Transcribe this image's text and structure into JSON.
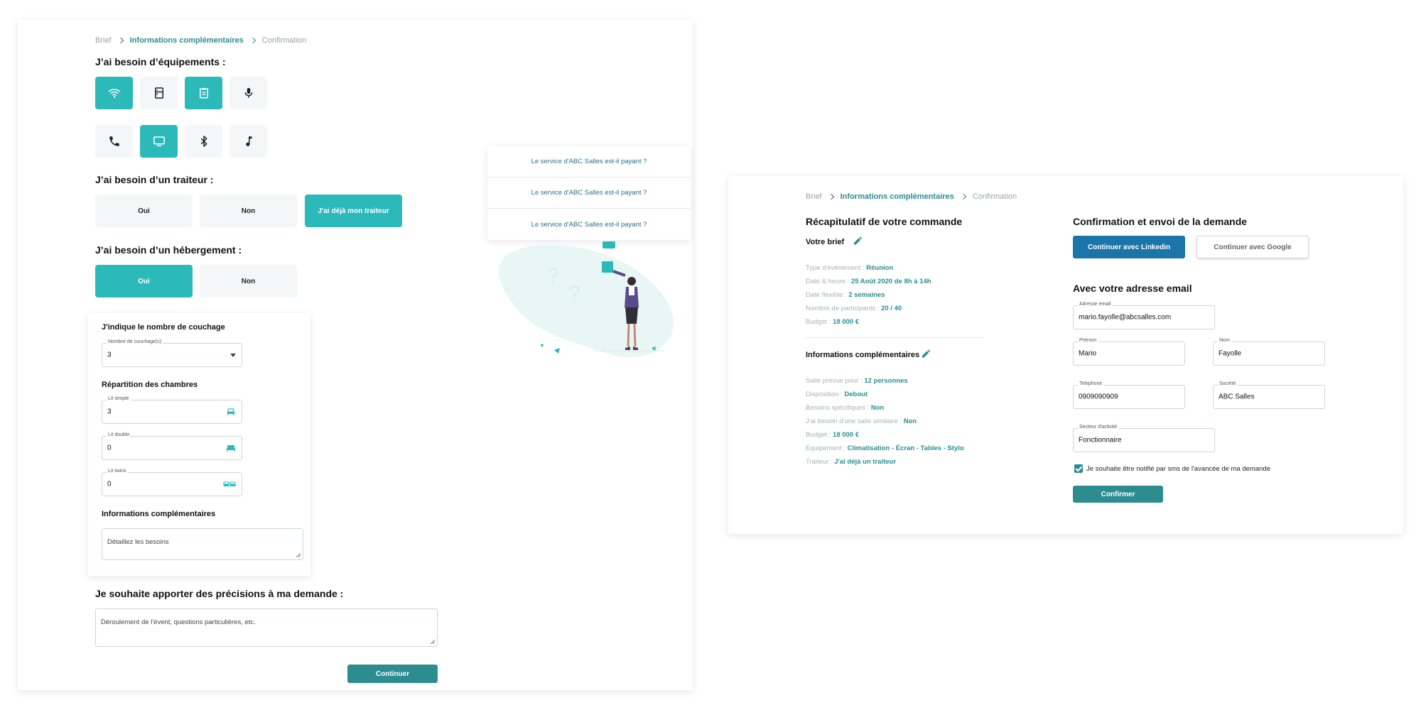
{
  "left": {
    "breadcrumb": [
      "Brief",
      "Informations complémentaires",
      "Confirmation"
    ],
    "equipment_title": "J’ai besoin d’équipements :",
    "equipment": [
      {
        "icon": "wifi-icon",
        "selected": true
      },
      {
        "icon": "fridge-icon",
        "selected": false
      },
      {
        "icon": "clipboard-icon",
        "selected": true
      },
      {
        "icon": "microphone-icon",
        "selected": false
      },
      {
        "icon": "phone-icon",
        "selected": false
      },
      {
        "icon": "monitor-icon",
        "selected": true
      },
      {
        "icon": "bluetooth-icon",
        "selected": false
      },
      {
        "icon": "music-note-icon",
        "selected": false
      }
    ],
    "traiteur_title": "J’ai besoin d’un traiteur :",
    "traiteur_options": [
      "Oui",
      "Non",
      "J'ai déjà mon traiteur"
    ],
    "traiteur_selected": "J'ai déjà mon traiteur",
    "hebergement_title": "J’ai besoin d’un hébergement :",
    "hebergement_options": [
      "Oui",
      "Non"
    ],
    "hebergement_selected": "Oui",
    "couchage": {
      "title": "J'indique le nombre de couchage",
      "select_label": "Nombre de couchage(s)",
      "select_value": "3",
      "repartition_title": "Répartition des chambres",
      "lit_simple_label": "Lit simple",
      "lit_simple_value": "3",
      "lit_double_label": "Lit double",
      "lit_double_value": "0",
      "lit_twins_label": "Lit twins",
      "lit_twins_value": "0",
      "infos_title": "Informations complémentaires",
      "infos_placeholder": "Détaillez les besoins"
    },
    "precisions_title": "Je souhaite apporter des précisions à ma demande :",
    "precisions_placeholder": "Déroulement de l'évent, questions particulières, etc.",
    "continue_label": "Continuer",
    "faq": [
      "Le service d'ABC Salles est-il payant ?",
      "Le service d'ABC Salles est-il payant ?",
      "Le service d'ABC Salles est-il payant ?"
    ],
    "accent_color": "#2cb9b9"
  },
  "right": {
    "breadcrumb": [
      "Brief",
      "Informations complémentaires",
      "Confirmation"
    ],
    "recap_title": "Récapitulatif de votre commande",
    "brief_title": "Votre brief",
    "brief": [
      {
        "label": "Type d'évènement : ",
        "value": "Réunion"
      },
      {
        "label": "Date & heure : ",
        "value": "25 Août 2020 de 8h à 14h"
      },
      {
        "label": "Date flexible : ",
        "value": "2 semaines"
      },
      {
        "label": "Nombre de participants : ",
        "value": "20 / 40"
      },
      {
        "label": "Budget : ",
        "value": "18 000 €"
      }
    ],
    "infos_title": "Informations complémentaires",
    "infos": [
      {
        "label": "Salle prévue pour : ",
        "value": "12 personnes"
      },
      {
        "label": "Disposition : ",
        "value": "Debout"
      },
      {
        "label": "Besoins spécifiques : ",
        "value": "Non"
      },
      {
        "label": "J'ai besoin d'une salle similaire : ",
        "value": "Non"
      },
      {
        "label": "Budget : ",
        "value": "18 000 €"
      },
      {
        "label": "Équipement : ",
        "value": "Climatisation - Écran - Tables - Stylo"
      },
      {
        "label": "Traiteur : ",
        "value": "J'ai déjà un traiteur"
      }
    ],
    "confirm_title": "Confirmation et envoi de la demande",
    "linkedin_label": "Continuer avec Linkedin",
    "google_label": "Continuer avec Google",
    "email_title": "Avec votre adresse email",
    "fields": {
      "email_label": "Adresse email",
      "email_value": "mario.fayolle@abcsalles.com",
      "prenom_label": "Prénom",
      "prenom_value": "Mario",
      "nom_label": "Nom",
      "nom_value": "Fayolle",
      "tel_label": "Telephone",
      "tel_value": "0909090909",
      "societe_label": "Société",
      "societe_value": "ABC Salles",
      "secteur_label": "Secteur d'activité",
      "secteur_value": "Fonctionnaire"
    },
    "sms_label": "Je souhaite être notifié par sms de l'avancée de ma demande",
    "confirm_label": "Confirmer",
    "linkedin_color": "#1c75a8"
  }
}
